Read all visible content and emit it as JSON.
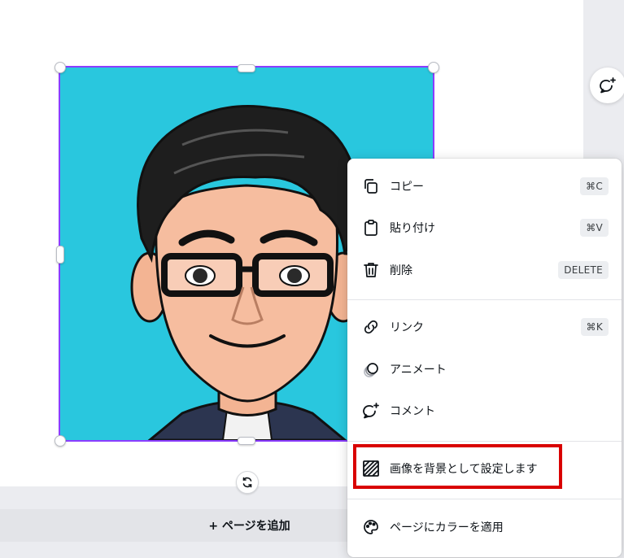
{
  "canvas": {
    "add_page_label": "+ ページを追加",
    "rotate_icon": "rotate-icon",
    "comment_icon": "comment-plus-icon",
    "selection_color": "#8b3dff",
    "image_background": "#29c7de"
  },
  "context_menu": {
    "items": [
      {
        "label": "コピー",
        "shortcut": "⌘C",
        "icon": "copy-icon"
      },
      {
        "label": "貼り付け",
        "shortcut": "⌘V",
        "icon": "paste-icon"
      },
      {
        "label": "削除",
        "shortcut": "DELETE",
        "icon": "trash-icon"
      },
      {
        "label": "リンク",
        "shortcut": "⌘K",
        "icon": "link-icon"
      },
      {
        "label": "アニメート",
        "shortcut": "",
        "icon": "animate-icon"
      },
      {
        "label": "コメント",
        "shortcut": "",
        "icon": "comment-plus-icon"
      },
      {
        "label": "画像を背景として設定します",
        "shortcut": "",
        "icon": "set-background-icon"
      },
      {
        "label": "ページにカラーを適用",
        "shortcut": "",
        "icon": "palette-icon"
      }
    ],
    "highlight_color": "#d90000"
  }
}
